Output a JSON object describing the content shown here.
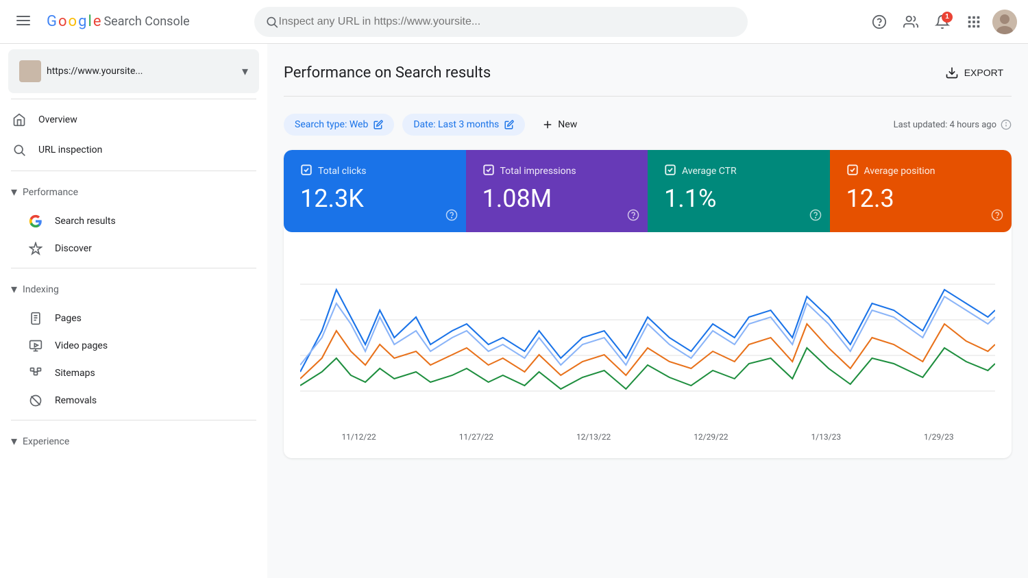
{
  "topbar": {
    "logo": {
      "google_letters": [
        "G",
        "o",
        "o",
        "g",
        "l",
        "e"
      ],
      "app_name": "Search Console"
    },
    "search_placeholder": "Inspect any URL in https://www.yoursite...",
    "notification_count": "1"
  },
  "sidebar": {
    "site_url": "https://www.yoursite...",
    "nav": {
      "overview_label": "Overview",
      "url_inspection_label": "URL inspection",
      "performance_label": "Performance",
      "search_results_label": "Search results",
      "discover_label": "Discover",
      "indexing_label": "Indexing",
      "pages_label": "Pages",
      "video_pages_label": "Video pages",
      "sitemaps_label": "Sitemaps",
      "removals_label": "Removals",
      "experience_label": "Experience"
    }
  },
  "content": {
    "page_title": "Performance on Search results",
    "export_label": "EXPORT",
    "filters": {
      "search_type_label": "Search type: Web",
      "date_label": "Date: Last 3 months",
      "new_label": "New",
      "last_updated": "Last updated: 4 hours ago"
    },
    "metrics": {
      "total_clicks": {
        "label": "Total clicks",
        "value": "12.3K"
      },
      "total_impressions": {
        "label": "Total impressions",
        "value": "1.08M"
      },
      "average_ctr": {
        "label": "Average CTR",
        "value": "1.1%"
      },
      "average_position": {
        "label": "Average position",
        "value": "12.3"
      }
    },
    "chart": {
      "dates": [
        "11/12/22",
        "11/27/22",
        "12/13/22",
        "12/29/22",
        "1/13/23",
        "1/29/23"
      ]
    }
  }
}
